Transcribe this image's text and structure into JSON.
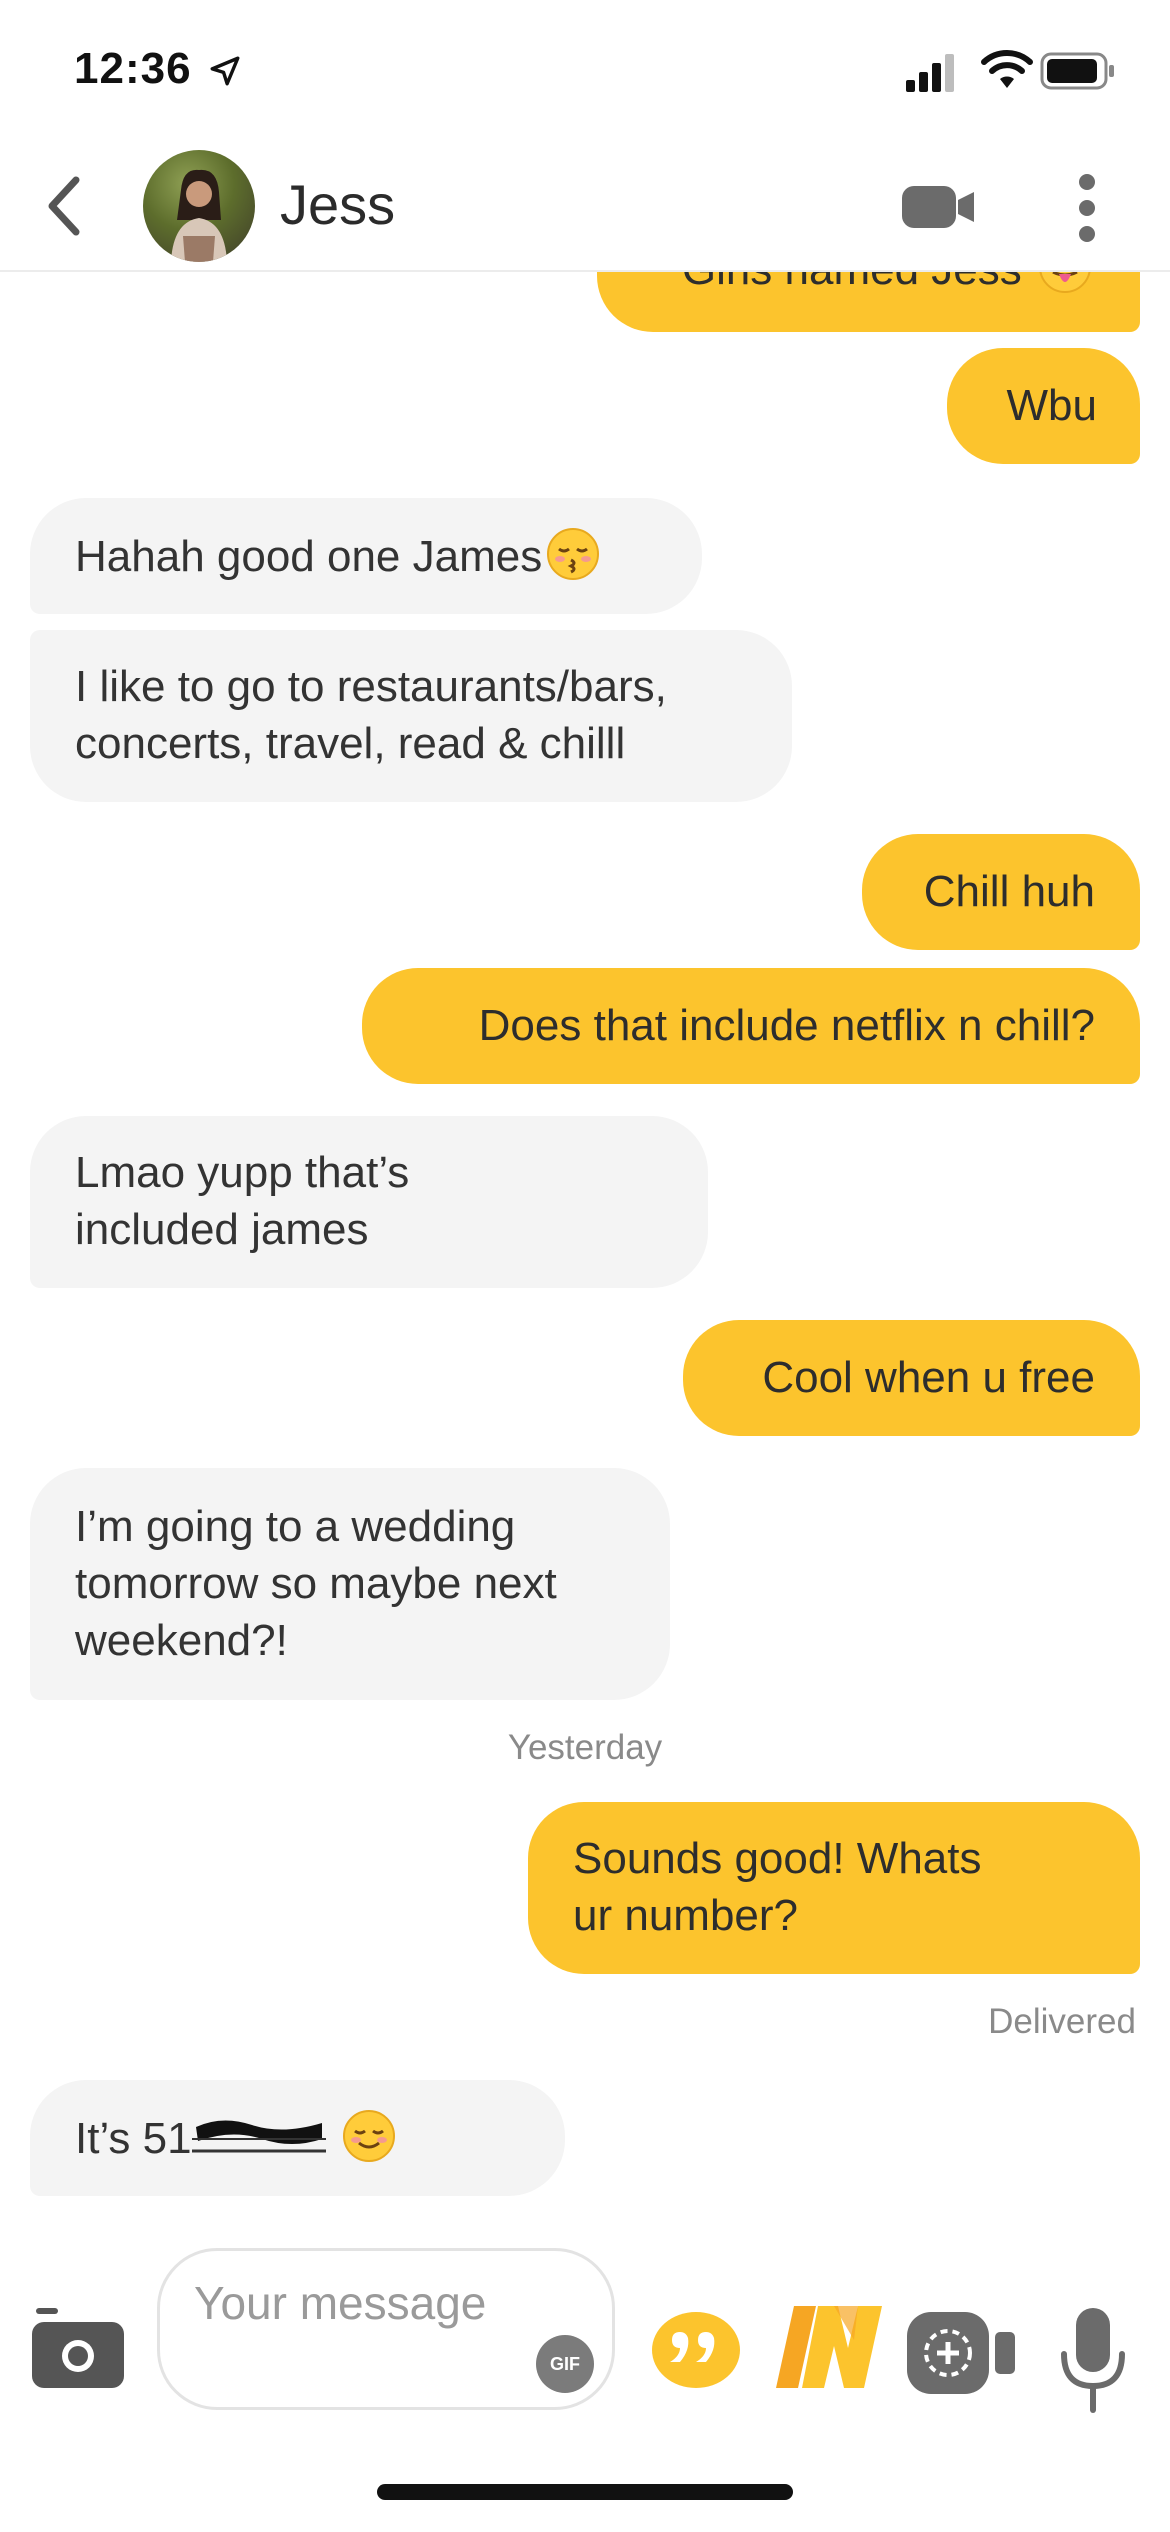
{
  "status_bar": {
    "time": "12:36"
  },
  "header": {
    "contact_name": "Jess"
  },
  "messages": [
    {
      "text": "Girls named Jess",
      "emoji": "tongue-wink-emoji"
    },
    {
      "text": "Wbu"
    },
    {
      "text": "Hahah good one James",
      "emoji": "kissing-emoji"
    },
    {
      "line1": "I like to go to restaurants/bars,",
      "line2": "concerts, travel, read & chilll"
    },
    {
      "text": "Chill huh"
    },
    {
      "text": "Does that include netflix n chill?"
    },
    {
      "line1": "Lmao yupp that’s",
      "line2": "included james"
    },
    {
      "text": "Cool when u free"
    },
    {
      "line1": "I’m going to a wedding",
      "line2": "tomorrow so maybe next",
      "line3": "weekend?!"
    },
    {
      "line1": "Sounds good! Whats",
      "line2": "ur number?"
    },
    {
      "text": "It’s 51",
      "emoji": "smiling-emoji"
    }
  ],
  "separator": "Yesterday",
  "delivered": "Delivered",
  "composer": {
    "placeholder": "Your message",
    "gif_label": "GIF"
  },
  "colors": {
    "outgoing": "#fcc42d",
    "incoming": "#f4f4f4",
    "text": "#333333"
  }
}
